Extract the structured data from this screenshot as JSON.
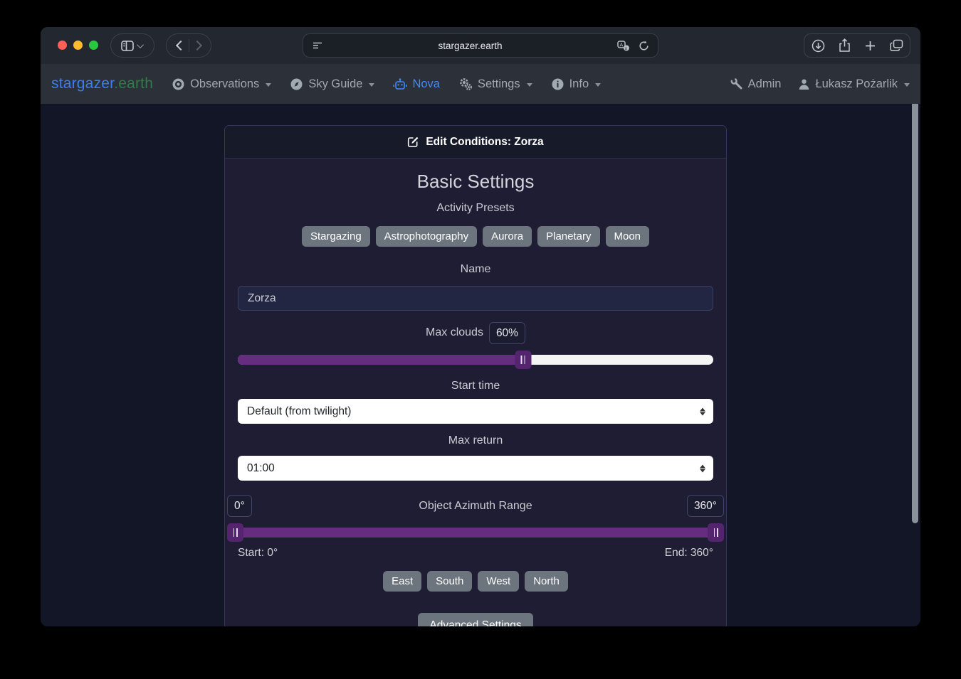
{
  "browser": {
    "url": "stargazer.earth",
    "traffic_light_colors": {
      "close": "#ff5f57",
      "minimize": "#febc2e",
      "zoom": "#2ac840"
    }
  },
  "navbar": {
    "logo": {
      "part1": "stargazer",
      "part2": ".earth",
      "color1": "#3c7ef2",
      "color2": "#2e7d4b"
    },
    "items": [
      {
        "label": "Observations"
      },
      {
        "label": "Sky Guide"
      },
      {
        "label": "Nova",
        "color": "#3e8bfd"
      },
      {
        "label": "Settings"
      },
      {
        "label": "Info"
      }
    ],
    "right": [
      {
        "label": "Admin"
      },
      {
        "label": "Łukasz Pożarlik"
      }
    ]
  },
  "form": {
    "header": "Edit Conditions: Zorza",
    "section_title": "Basic Settings",
    "presets_label": "Activity Presets",
    "presets": [
      "Stargazing",
      "Astrophotography",
      "Aurora",
      "Planetary",
      "Moon"
    ],
    "name": {
      "label": "Name",
      "value": "Zorza"
    },
    "max_clouds": {
      "label": "Max clouds",
      "value": "60%",
      "percent": 60
    },
    "start_time": {
      "label": "Start time",
      "value": "Default (from twilight)"
    },
    "max_return": {
      "label": "Max return",
      "value": "01:00"
    },
    "azimuth": {
      "label": "Object Azimuth Range",
      "min_badge": "0°",
      "max_badge": "360°",
      "start_label": "Start: 0°",
      "end_label": "End: 360°",
      "start_deg": 0,
      "end_deg": 360
    },
    "directions": [
      "East",
      "South",
      "West",
      "North"
    ],
    "advanced_button": "Advanced Settings",
    "accent_purple": "#652c80",
    "button_gray": "#6c757d"
  }
}
